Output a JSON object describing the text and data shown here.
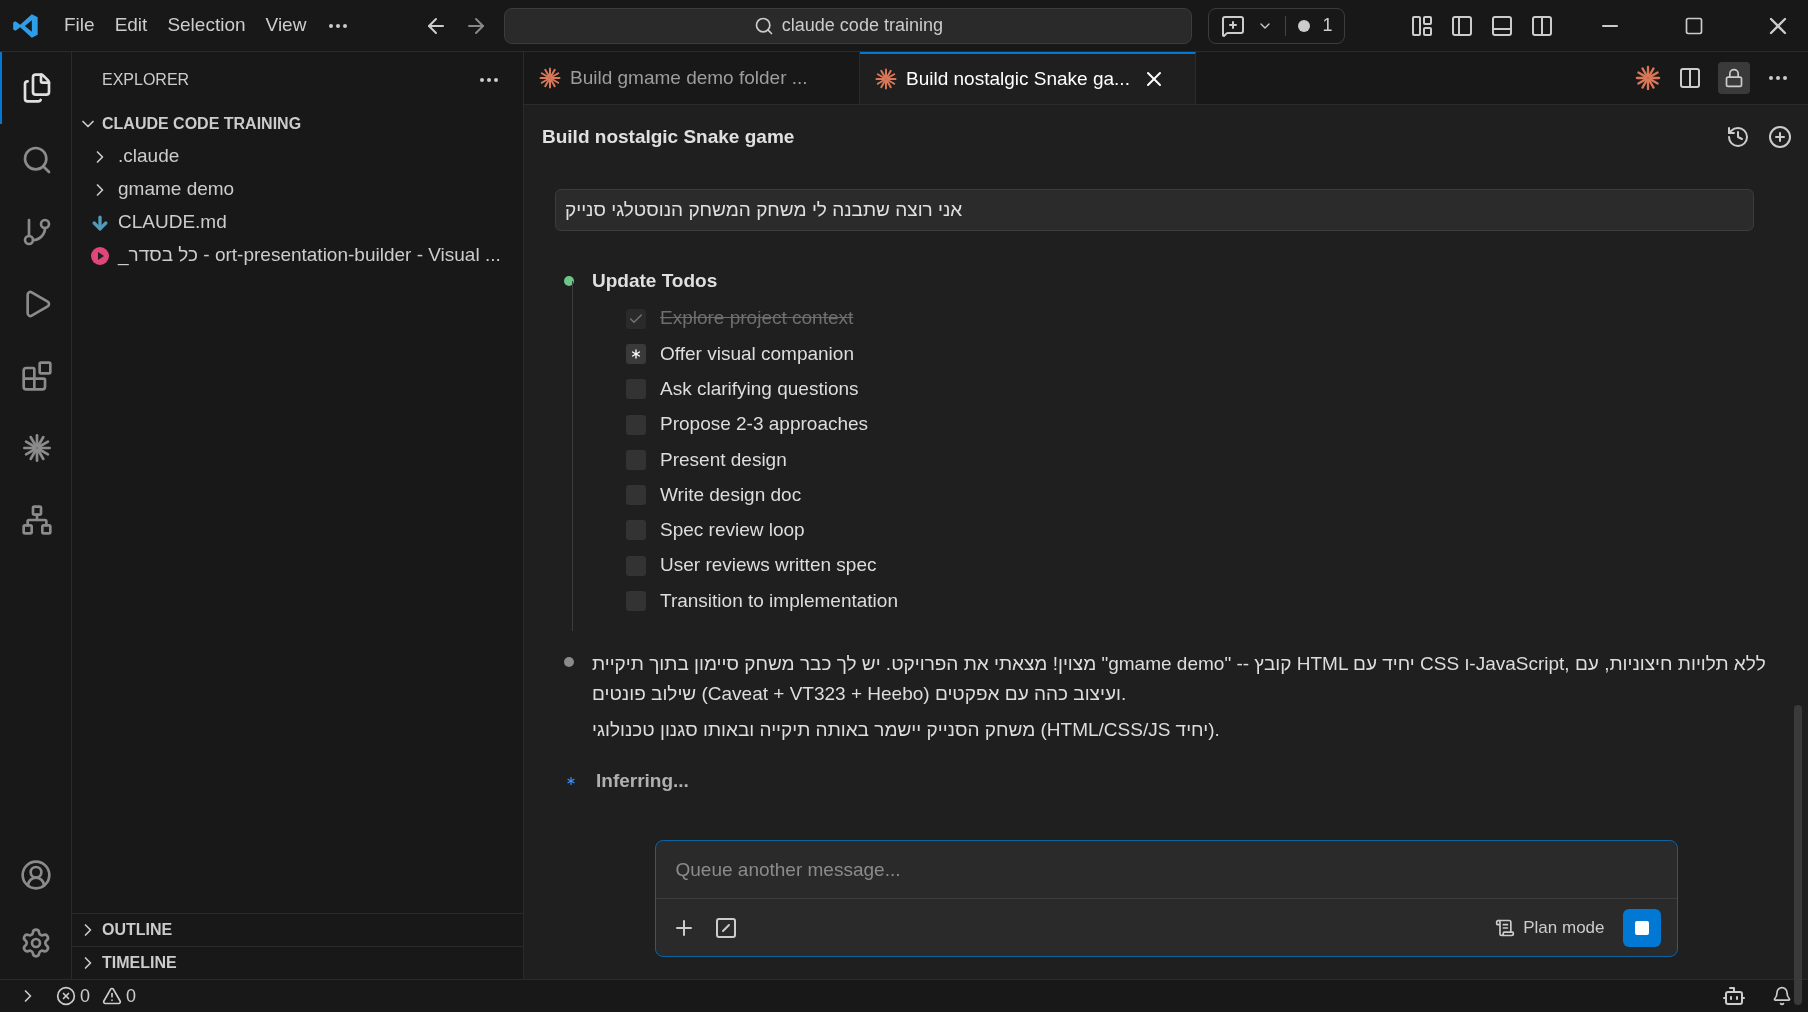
{
  "menu": [
    "File",
    "Edit",
    "Selection",
    "View"
  ],
  "search": {
    "value": "claude code training"
  },
  "notifications_badge": "1",
  "activity": [
    {
      "kind": "files",
      "selected": true
    },
    {
      "kind": "search",
      "selected": false
    },
    {
      "kind": "source-control",
      "selected": false
    },
    {
      "kind": "run",
      "selected": false
    },
    {
      "kind": "extensions",
      "selected": false
    },
    {
      "kind": "claude",
      "selected": false
    },
    {
      "kind": "remote",
      "selected": false
    }
  ],
  "explorer": {
    "title": "EXPLORER",
    "root": {
      "label": "CLAUDE CODE TRAINING",
      "expanded": true,
      "children": [
        {
          "label": ".claude",
          "kind": "folder",
          "expanded": false
        },
        {
          "label": "gmame demo",
          "kind": "folder",
          "expanded": false
        },
        {
          "label": "CLAUDE.md",
          "kind": "markdown"
        },
        {
          "label": "_כל בסדר - ort-presentation-builder - Visual ...",
          "kind": "video"
        }
      ]
    }
  },
  "panels": [
    {
      "label": "OUTLINE",
      "expanded": false
    },
    {
      "label": "TIMELINE",
      "expanded": false
    }
  ],
  "tabs": [
    {
      "label": "Build gmame demo folder ...",
      "selected": false
    },
    {
      "label": "Build nostalgic Snake ga...",
      "selected": true
    }
  ],
  "chat": {
    "title": "Build nostalgic Snake game",
    "user_message": "אני רוצה שתבנה לי משחק המשחק הנוסטלגי סנייק",
    "tool": {
      "title": "Update Todos",
      "todos": [
        {
          "label": "Explore project context",
          "kind": "done",
          "checked": true
        },
        {
          "label": "Offer visual companion",
          "kind": "active",
          "checked": false
        },
        {
          "label": "Ask clarifying questions",
          "kind": "pending",
          "checked": false
        },
        {
          "label": "Propose 2-3 approaches",
          "kind": "pending",
          "checked": false
        },
        {
          "label": "Present design",
          "kind": "pending",
          "checked": false
        },
        {
          "label": "Write design doc",
          "kind": "pending",
          "checked": false
        },
        {
          "label": "Spec review loop",
          "kind": "pending",
          "checked": false
        },
        {
          "label": "User reviews written spec",
          "kind": "pending",
          "checked": false
        },
        {
          "label": "Transition to implementation",
          "kind": "pending",
          "checked": false
        }
      ]
    },
    "reply": [
      "מצוין! מצאתי את הפרויקט. יש לך כבר משחק סיימון בתוך תיקיית \"gmame demo\" -- קובץ HTML יחיד עם CSS ו-JavaScript, ללא תלויות חיצוניות, עם שילוב פונטים (Caveat + VT323 + Heebo) ועיצוב כהה עם אפקטים.",
      "משחק הסנייק יישמר באותה תיקייה ובאותו סגנון טכנולוגי (HTML/CSS/JS יחיד)."
    ],
    "progress": "Inferring...",
    "composer": {
      "placeholder": "Queue another message...",
      "mode": "Plan mode"
    }
  },
  "status_bar": {
    "errors": "0",
    "warnings": "0"
  }
}
